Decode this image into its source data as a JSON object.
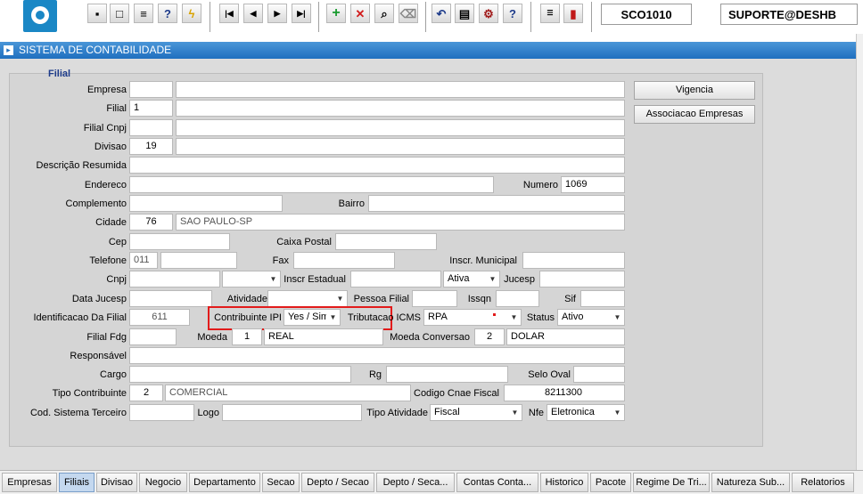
{
  "toolbar": {
    "screen_code": "SCO1010",
    "user": "SUPORTE@DESHB",
    "icons": [
      "save-icon",
      "window-icon",
      "print-icon",
      "help-search-icon",
      "lightning-icon",
      "first-record-icon",
      "previous-record-icon",
      "next-record-icon",
      "last-record-icon",
      "insert-record-icon",
      "delete-record-icon",
      "find-icon",
      "clear-icon",
      "undo-icon",
      "clipboard-icon",
      "settings-icon",
      "help-icon",
      "menu-icon",
      "exit-icon"
    ]
  },
  "window": {
    "title": "SISTEMA DE CONTABILIDADE"
  },
  "section": {
    "legend": "Filial"
  },
  "labels": {
    "empresa": "Empresa",
    "filial": "Filial",
    "filial_cnpj": "Filial Cnpj",
    "divisao": "Divisao",
    "descricao_resumida": "Descrição Resumida",
    "endereco": "Endereco",
    "numero": "Numero",
    "complemento": "Complemento",
    "bairro": "Bairro",
    "cidade": "Cidade",
    "cep": "Cep",
    "caixa_postal": "Caixa Postal",
    "telefone": "Telefone",
    "fax": "Fax",
    "inscr_municipal": "Inscr. Municipal",
    "cnpj": "Cnpj",
    "inscr_estadual": "Inscr Estadual",
    "jucesp": "Jucesp",
    "data_jucesp": "Data Jucesp",
    "atividade": "Atividade",
    "pessoa_filial": "Pessoa Filial",
    "issqn": "Issqn",
    "sif": "Sif",
    "identificacao_filial": "Identificacao Da Filial",
    "contribuinte_ipi": "Contribuinte IPI",
    "tributacao_icms": "Tributacao ICMS",
    "status": "Status",
    "filial_fdg": "Filial Fdg",
    "moeda": "Moeda",
    "moeda_conversao": "Moeda Conversao",
    "responsavel": "Responsável",
    "cargo": "Cargo",
    "rg": "Rg",
    "selo_oval": "Selo Oval",
    "tipo_contribuinte": "Tipo Contribuinte",
    "codigo_cnae_fiscal": "Codigo Cnae Fiscal",
    "cod_sistema_terceiro": "Cod. Sistema Terceiro",
    "logo": "Logo",
    "tipo_atividade": "Tipo Atividade",
    "nfe": "Nfe"
  },
  "values": {
    "filial": "1",
    "divisao": "19",
    "numero": "1069",
    "cidade_code": "76",
    "cidade_name": "SAO PAULO-SP",
    "telefone_ddd": "011",
    "inscr_estadual_status": "Ativa",
    "identificacao_filial": "611",
    "contribuinte_ipi": "Yes / Sim",
    "tributacao_icms": "RPA",
    "status": "Ativo",
    "moeda_code": "1",
    "moeda_name": "REAL",
    "moeda_conversao_code": "2",
    "moeda_conversao_name": "DOLAR",
    "tipo_contribuinte_code": "2",
    "tipo_contribuinte_name": "COMERCIAL",
    "codigo_cnae_fiscal": "8211300",
    "tipo_atividade": "Fiscal",
    "nfe": "Eletronica"
  },
  "buttons": {
    "vigencia": "Vigencia",
    "associacao_empresas": "Associacao Empresas"
  },
  "tabs": [
    {
      "label": "Empresas",
      "active": false
    },
    {
      "label": "Filiais",
      "active": true
    },
    {
      "label": "Divisao",
      "active": false
    },
    {
      "label": "Negocio",
      "active": false
    },
    {
      "label": "Departamento",
      "active": false
    },
    {
      "label": "Secao",
      "active": false
    },
    {
      "label": "Depto / Secao",
      "active": false
    },
    {
      "label": "Depto / Seca...",
      "active": false
    },
    {
      "label": "Contas Conta...",
      "active": false
    },
    {
      "label": "Historico",
      "active": false
    },
    {
      "label": "Pacote",
      "active": false
    },
    {
      "label": "Regime De Tri...",
      "active": false
    },
    {
      "label": "Natureza Sub...",
      "active": false
    },
    {
      "label": "Relatorios",
      "active": false
    }
  ],
  "colors": {
    "highlight": "#e21b1b",
    "title_bar": "#1f6fbf",
    "active_tab": "#c4d8ef"
  }
}
